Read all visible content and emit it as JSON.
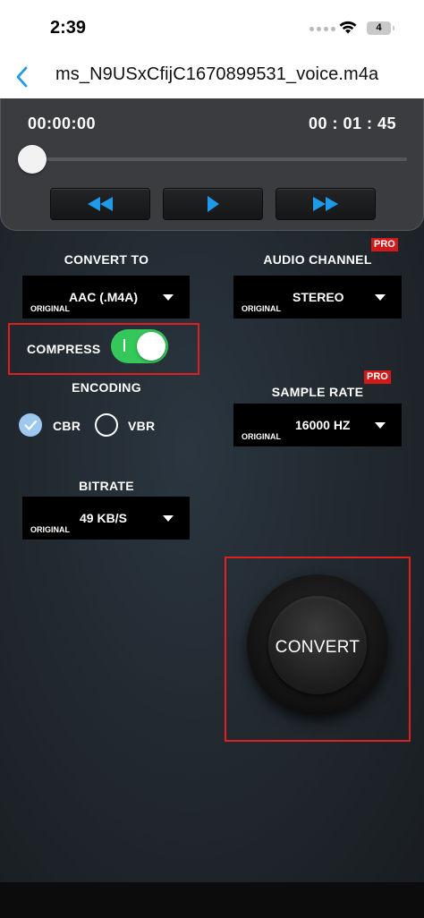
{
  "status": {
    "time": "2:39",
    "battery": "4"
  },
  "nav": {
    "title": "ms_N9USxCfijC1670899531_voice.m4a"
  },
  "player": {
    "current_time": "00:00:00",
    "total_time": "00 : 01 : 45",
    "progress": 0
  },
  "convert_to": {
    "label": "CONVERT TO",
    "sub": "ORIGINAL",
    "value": "AAC (.M4A)"
  },
  "audio_channel": {
    "label": "AUDIO CHANNEL",
    "badge": "PRO",
    "sub": "ORIGINAL",
    "value": "STEREO"
  },
  "compress": {
    "label": "COMPRESS",
    "enabled": true
  },
  "encoding": {
    "label": "ENCODING",
    "options": [
      {
        "label": "CBR",
        "selected": true
      },
      {
        "label": "VBR",
        "selected": false
      }
    ]
  },
  "sample_rate": {
    "label": "SAMPLE RATE",
    "badge": "PRO",
    "sub": "ORIGINAL",
    "value": "16000 HZ"
  },
  "bitrate": {
    "label": "BITRATE",
    "sub": "ORIGINAL",
    "value": "49 KB/S"
  },
  "convert_button": {
    "label": "CONVERT"
  },
  "colors": {
    "accent_blue": "#1e9be8",
    "toggle_on": "#34c759",
    "highlight_red": "#e02020",
    "pro_red": "#d31a1a"
  }
}
